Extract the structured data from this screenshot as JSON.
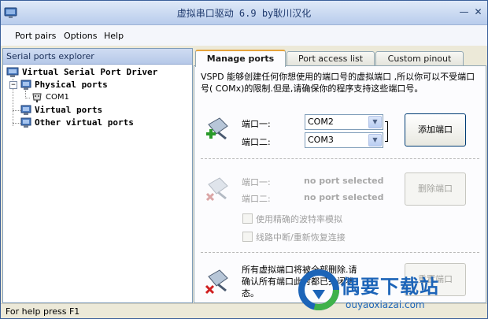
{
  "window": {
    "title": "虚拟串口驱动 6.9 by耿川汉化",
    "minimize_glyph": "—",
    "close_glyph": "✕"
  },
  "menu": {
    "items": [
      "Port pairs",
      "Options",
      "Help"
    ]
  },
  "explorer": {
    "header": "Serial ports explorer",
    "root": "Virtual Serial Port Driver",
    "physical": "Physical ports",
    "com1": "COM1",
    "virtual": "Virtual ports",
    "other": "Other virtual ports",
    "expander_minus": "−"
  },
  "tabs": [
    "Manage ports",
    "Port access list",
    "Custom pinout"
  ],
  "manage": {
    "description": "VSPD 能够创建任何你想使用的端口号的虚拟端口 ,所以你可以不受端口号( COMx)的限制.但是,请确保你的程序支持这些端口号。",
    "add": {
      "port1_label": "端口一:",
      "port2_label": "端口二:",
      "port1_value": "COM2",
      "port2_value": "COM3",
      "button": "添加端口",
      "combo_arrow": "▼"
    },
    "remove": {
      "port1_label": "端口一:",
      "port2_label": "端口二:",
      "port1_value": "no port selected",
      "port2_value": "no port selected",
      "button": "删除端口",
      "option1": "使用精确的波特率模拟",
      "option2": "线路中断/重新恢复连接"
    },
    "reset": {
      "description": "所有虚拟端口将被全部删除.请确认所有端口此时都已关闭状态。",
      "button": "重置端口"
    }
  },
  "status": {
    "text": "For help press F1"
  },
  "watermark": {
    "title": "偶要下载站",
    "url": "ouyaoxiazai.com"
  },
  "colors": {
    "accent_blue": "#1c64b8",
    "tab_highlight": "#e6a43c",
    "border": "#7f9db9"
  }
}
